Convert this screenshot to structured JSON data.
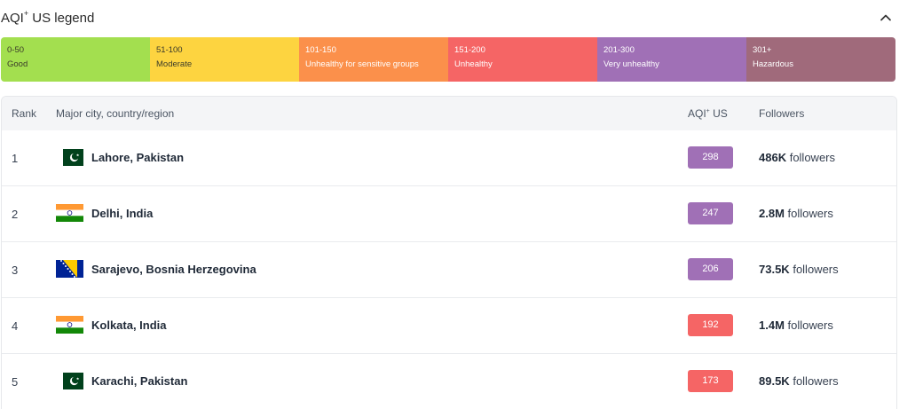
{
  "legend": {
    "title": "AQI",
    "title_sup": "+",
    "title_suffix": " US legend",
    "segments": [
      {
        "range": "0-50",
        "label": "Good",
        "color": "#a3df4f"
      },
      {
        "range": "51-100",
        "label": "Moderate",
        "color": "#fdd440"
      },
      {
        "range": "101-150",
        "label": "Unhealthy for sensitive groups",
        "color": "#fb904b"
      },
      {
        "range": "151-200",
        "label": "Unhealthy",
        "color": "#f56565"
      },
      {
        "range": "201-300",
        "label": "Very unhealthy",
        "color": "#a070b6"
      },
      {
        "range": "301+",
        "label": "Hazardous",
        "color": "#a06a7b"
      }
    ]
  },
  "table": {
    "headers": {
      "rank": "Rank",
      "city": "Major city, country/region",
      "aqi": "AQI",
      "aqi_sup": "+",
      "aqi_suffix": " US",
      "followers": "Followers"
    },
    "rows": [
      {
        "rank": "1",
        "city": "Lahore, Pakistan",
        "flag": "pakistan-flag",
        "aqi": "298",
        "aqi_color": "#a070b6",
        "followers_count": "486K",
        "followers_word": "followers"
      },
      {
        "rank": "2",
        "city": "Delhi, India",
        "flag": "india-flag",
        "aqi": "247",
        "aqi_color": "#a070b6",
        "followers_count": "2.8M",
        "followers_word": "followers"
      },
      {
        "rank": "3",
        "city": "Sarajevo, Bosnia Herzegovina",
        "flag": "bosnia-herzegovina-flag",
        "aqi": "206",
        "aqi_color": "#a070b6",
        "followers_count": "73.5K",
        "followers_word": "followers"
      },
      {
        "rank": "4",
        "city": "Kolkata, India",
        "flag": "india-flag",
        "aqi": "192",
        "aqi_color": "#f56565",
        "followers_count": "1.4M",
        "followers_word": "followers"
      },
      {
        "rank": "5",
        "city": "Karachi, Pakistan",
        "flag": "pakistan-flag",
        "aqi": "173",
        "aqi_color": "#f56565",
        "followers_count": "89.5K",
        "followers_word": "followers"
      }
    ]
  }
}
